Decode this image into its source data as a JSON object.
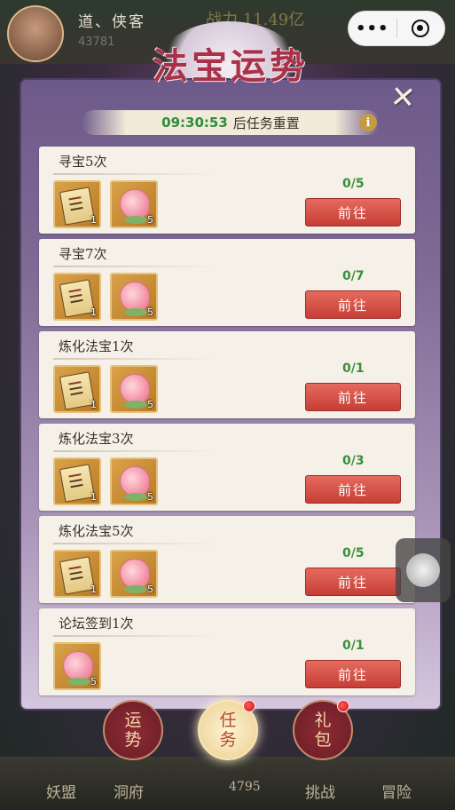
{
  "top": {
    "player_name": "道、侠客",
    "power_text": "战力 11.49亿",
    "sub_text": "43781"
  },
  "capsule": {
    "more_icon": "more-dots-icon",
    "close_icon": "target-icon"
  },
  "event": {
    "title": "法宝运势"
  },
  "timer": {
    "time": "09:30:53",
    "text": "后任务重置",
    "info": "i"
  },
  "tasks": [
    {
      "title": "寻宝5次",
      "progress": "0/5",
      "button": "前往",
      "rewards": [
        {
          "icon": "scroll",
          "count": "1"
        },
        {
          "icon": "peach",
          "count": "5"
        }
      ]
    },
    {
      "title": "寻宝7次",
      "progress": "0/7",
      "button": "前往",
      "rewards": [
        {
          "icon": "scroll",
          "count": "1"
        },
        {
          "icon": "peach",
          "count": "5"
        }
      ]
    },
    {
      "title": "炼化法宝1次",
      "progress": "0/1",
      "button": "前往",
      "rewards": [
        {
          "icon": "scroll",
          "count": "1"
        },
        {
          "icon": "peach",
          "count": "5"
        }
      ]
    },
    {
      "title": "炼化法宝3次",
      "progress": "0/3",
      "button": "前往",
      "rewards": [
        {
          "icon": "scroll",
          "count": "1"
        },
        {
          "icon": "peach",
          "count": "5"
        }
      ]
    },
    {
      "title": "炼化法宝5次",
      "progress": "0/5",
      "button": "前往",
      "rewards": [
        {
          "icon": "scroll",
          "count": "1"
        },
        {
          "icon": "peach",
          "count": "5"
        }
      ]
    },
    {
      "title": "论坛签到1次",
      "progress": "0/1",
      "button": "前往",
      "rewards": [
        {
          "icon": "peach",
          "count": "5"
        }
      ]
    }
  ],
  "tabs": {
    "fortune": {
      "line1": "运",
      "line2": "势"
    },
    "task": {
      "line1": "任",
      "line2": "务"
    },
    "gift": {
      "line1": "礼",
      "line2": "包"
    }
  },
  "bottom_nav": {
    "item1": "妖盟",
    "item2": "洞府",
    "item3": "4795",
    "item4": "挑战",
    "item5": "冒险"
  },
  "colors": {
    "accent_red": "#c63e35",
    "progress_green": "#3a8f3a",
    "panel_purple": "#7f6a95"
  }
}
